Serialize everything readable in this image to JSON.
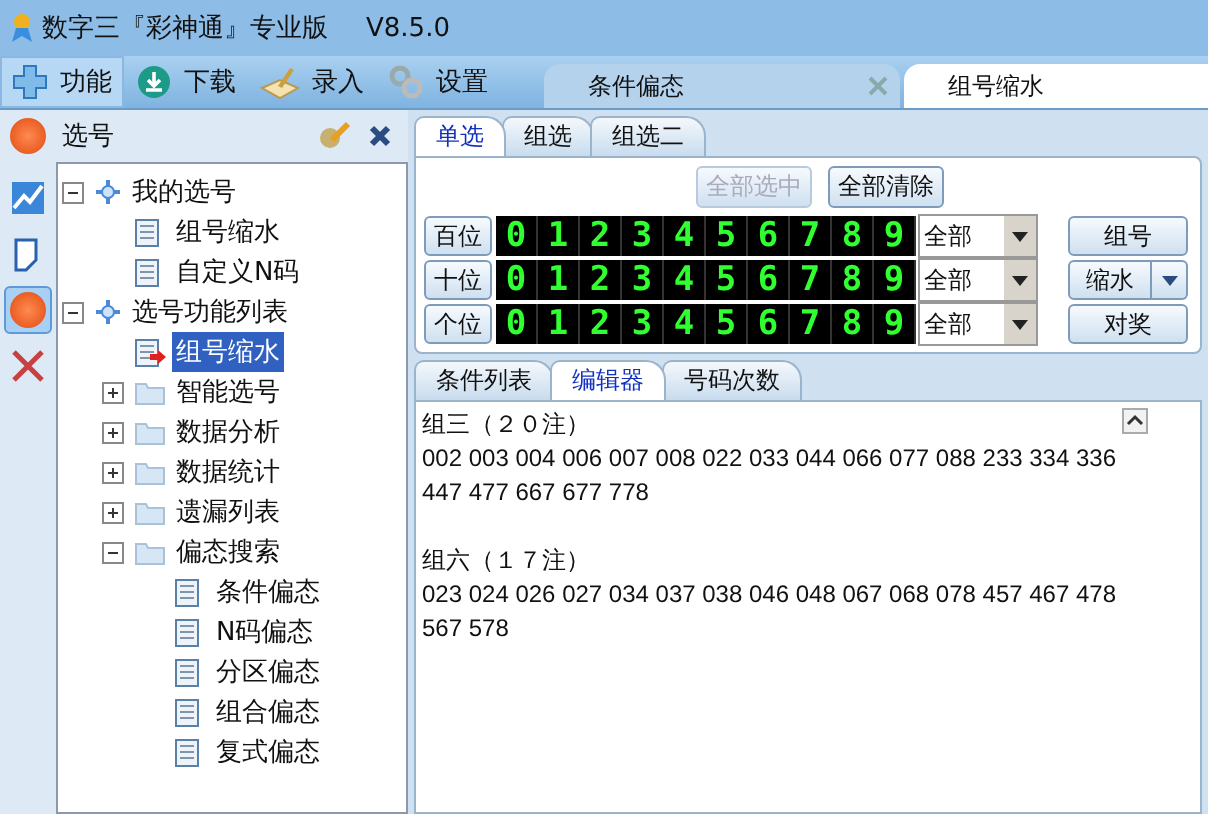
{
  "window": {
    "title": "数字三『彩神通』专业版",
    "version": "V8.5.0"
  },
  "toolbar": [
    {
      "label": "功能",
      "kind": "plus",
      "selected": true
    },
    {
      "label": "下载",
      "kind": "download",
      "selected": false
    },
    {
      "label": "录入",
      "kind": "entry",
      "selected": false
    },
    {
      "label": "设置",
      "kind": "gear",
      "selected": false
    }
  ],
  "doc_tabs": [
    {
      "label": "条件偏态",
      "selected": false
    },
    {
      "label": "组号缩水",
      "selected": true
    }
  ],
  "sidebar": {
    "title": "选号",
    "strip": [
      {
        "kind": "chart",
        "selected": false
      },
      {
        "kind": "note",
        "selected": false
      },
      {
        "kind": "pick",
        "selected": true
      },
      {
        "kind": "tools",
        "selected": false
      }
    ],
    "tree": [
      {
        "label": "我的选号",
        "kind": "node",
        "expanded": true,
        "selected": false,
        "children": [
          {
            "label": "组号缩水",
            "kind": "doc",
            "selected": false
          },
          {
            "label": "自定义N码",
            "kind": "doc",
            "selected": false
          }
        ]
      },
      {
        "label": "选号功能列表",
        "kind": "node",
        "expanded": true,
        "selected": false,
        "children": [
          {
            "label": "组号缩水",
            "kind": "current",
            "selected": true
          },
          {
            "label": "智能选号",
            "kind": "folder",
            "expanded": false,
            "selected": false
          },
          {
            "label": "数据分析",
            "kind": "folder",
            "expanded": false,
            "selected": false
          },
          {
            "label": "数据统计",
            "kind": "folder",
            "expanded": false,
            "selected": false
          },
          {
            "label": "遗漏列表",
            "kind": "folder",
            "expanded": false,
            "selected": false
          },
          {
            "label": "偏态搜索",
            "kind": "folder",
            "expanded": true,
            "selected": false,
            "children": [
              {
                "label": "条件偏态",
                "kind": "doc",
                "selected": false
              },
              {
                "label": "N码偏态",
                "kind": "doc",
                "selected": false
              },
              {
                "label": "分区偏态",
                "kind": "doc",
                "selected": false
              },
              {
                "label": "组合偏态",
                "kind": "doc",
                "selected": false
              },
              {
                "label": "复式偏态",
                "kind": "doc",
                "selected": false
              }
            ]
          }
        ]
      }
    ]
  },
  "pick_tabs": [
    {
      "label": "单选",
      "selected": true
    },
    {
      "label": "组选",
      "selected": false
    },
    {
      "label": "组选二",
      "selected": false
    }
  ],
  "actions": [
    {
      "label": "全部选中",
      "disabled": true
    },
    {
      "label": "全部清除",
      "disabled": false
    }
  ],
  "positions": [
    {
      "label": "百位",
      "digits": [
        "0",
        "1",
        "2",
        "3",
        "4",
        "5",
        "6",
        "7",
        "8",
        "9"
      ],
      "filter": "全部"
    },
    {
      "label": "十位",
      "digits": [
        "0",
        "1",
        "2",
        "3",
        "4",
        "5",
        "6",
        "7",
        "8",
        "9"
      ],
      "filter": "全部"
    },
    {
      "label": "个位",
      "digits": [
        "0",
        "1",
        "2",
        "3",
        "4",
        "5",
        "6",
        "7",
        "8",
        "9"
      ],
      "filter": "全部"
    }
  ],
  "side_buttons": [
    {
      "label": "组号",
      "kind": "plain"
    },
    {
      "label": "缩水",
      "kind": "split"
    },
    {
      "label": "对奖",
      "kind": "plain"
    }
  ],
  "result_tabs": [
    {
      "label": "条件列表",
      "selected": false
    },
    {
      "label": "编辑器",
      "selected": true
    },
    {
      "label": "号码次数",
      "selected": false
    }
  ],
  "editor": [
    {
      "heading": "组三（２０注）",
      "numbers": "002 003 004 006 007 008 022 033 044 066 077 088 233 334 336 447 477 667 677 778"
    },
    {
      "heading": "组六（１７注）",
      "numbers": "023 024 026 027 034 037 038 046 048 067 068 078 457 467 478 567 578"
    }
  ]
}
